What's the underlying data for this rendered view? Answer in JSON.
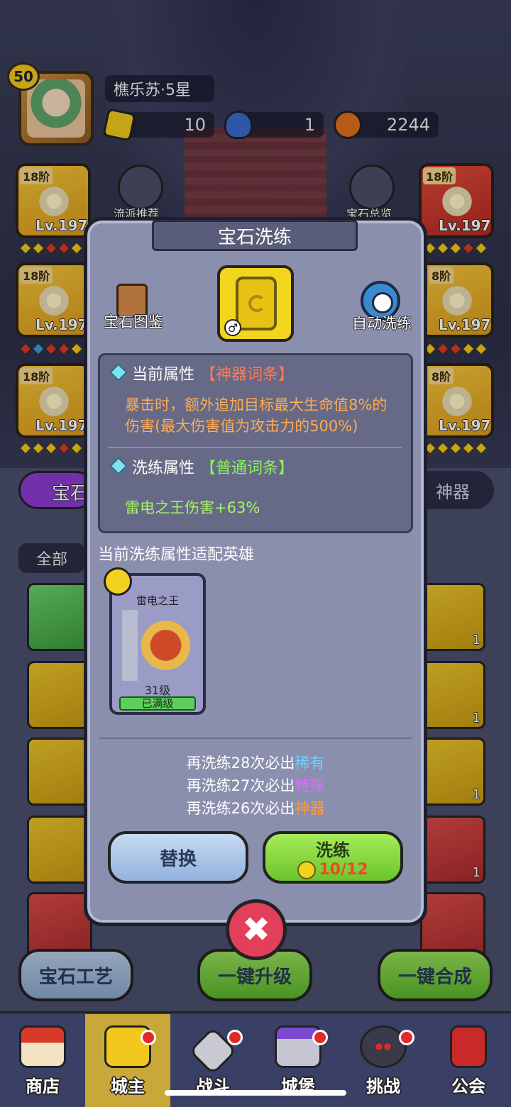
{
  "player": {
    "level": "50",
    "name": "樵乐苏·5星"
  },
  "resources": [
    {
      "icon": "gold-gem-plus-icon",
      "value": "10"
    },
    {
      "icon": "potion-plus-icon",
      "value": "1"
    },
    {
      "icon": "orange-coin-plus-icon",
      "value": "2244"
    }
  ],
  "side_buttons": {
    "left": "流派推荐",
    "right": "宝石总览"
  },
  "slots": {
    "tier": "18阶",
    "tier_cut": "8阶",
    "level": "Lv.197"
  },
  "tabs": {
    "gem": "宝石",
    "artifact": "神器",
    "all": "全部"
  },
  "gem_counts": [
    "1",
    "1",
    "1",
    "1"
  ],
  "actions": {
    "craft": "宝石工艺",
    "upgrade": "一键升级",
    "merge": "一键合成"
  },
  "nav": [
    {
      "label": "商店",
      "icon": "shop-icon",
      "dot": false
    },
    {
      "label": "城主",
      "icon": "crown-icon",
      "dot": true,
      "active": true
    },
    {
      "label": "战斗",
      "icon": "swords-icon",
      "dot": true
    },
    {
      "label": "城堡",
      "icon": "castle-icon",
      "dot": true
    },
    {
      "label": "挑战",
      "icon": "demon-icon",
      "dot": true
    },
    {
      "label": "公会",
      "icon": "banner-icon",
      "dot": false
    }
  ],
  "dialog": {
    "title": "宝石洗练",
    "handbook": "宝石图鉴",
    "auto_wash": "自动洗练",
    "current_attr": {
      "label": "当前属性",
      "tag": "【神器词条】",
      "desc_line1": "暴击时，额外追加目标最大生命值8%的",
      "desc_line2": "伤害(最大伤害值为攻击力的500%)"
    },
    "wash_attr": {
      "label": "洗练属性",
      "tag": "【普通词条】",
      "desc": "雷电之王伤害+63%"
    },
    "fit_label": "当前洗练属性适配英雄",
    "hero": {
      "name": "雷电之王",
      "level": "31级",
      "status": "已满级"
    },
    "progress": [
      {
        "text": "再洗练28次必出",
        "rarity": "稀有",
        "color": "blue"
      },
      {
        "text": "再洗练27次必出",
        "rarity": "特殊",
        "color": "purple"
      },
      {
        "text": "再洗练26次必出",
        "rarity": "神器",
        "color": "orange"
      }
    ],
    "replace_button": "替换",
    "wash_button": "洗练",
    "wash_cost": "10/12",
    "close_icon": "✖"
  },
  "colors": {
    "dialog_bg": "#8b8fae",
    "accent_gold": "#f2d21e",
    "close_red": "#e2405a"
  }
}
